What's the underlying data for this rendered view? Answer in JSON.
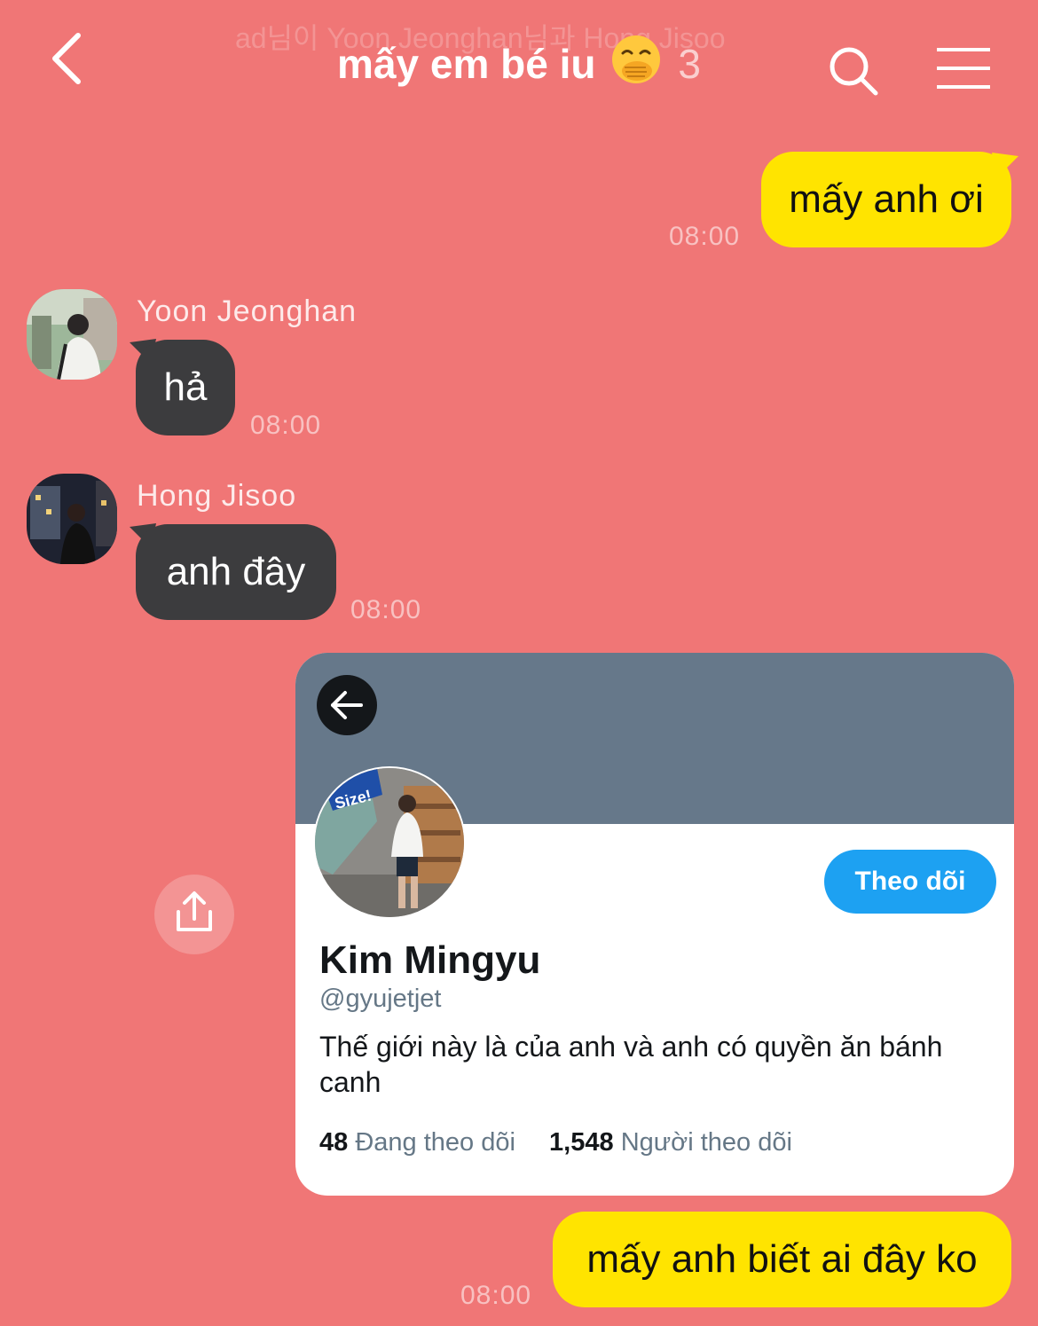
{
  "header": {
    "ghost_text": "ad님이 Yoon Jeonghan님과 Hong Jisoo",
    "title": "mấy em bé iu",
    "member_count": "3"
  },
  "messages": [
    {
      "sender": "me",
      "text": "mấy anh ơi",
      "time": "08:00"
    },
    {
      "sender": "Yoon Jeonghan",
      "text": "hả",
      "time": "08:00"
    },
    {
      "sender": "Hong Jisoo",
      "text": "anh đây",
      "time": "08:00"
    },
    {
      "sender": "me",
      "text": "mấy anh biết ai đây ko",
      "time": "08:00"
    }
  ],
  "profile_card": {
    "follow_label": "Theo dõi",
    "name": "Kim Mingyu",
    "handle": "@gyujetjet",
    "bio": "Thế giới này là của anh và anh có quyền ăn bánh canh",
    "following_count": "48",
    "following_label": "Đang theo dõi",
    "followers_count": "1,548",
    "followers_label": "Người theo dõi",
    "avatar_label": "Size!"
  },
  "colors": {
    "background": "#F07676",
    "my_bubble": "#FFE400",
    "their_bubble": "#3C3C3E",
    "follow_button": "#1DA1F2",
    "banner": "#66788A"
  },
  "icons": [
    "back-chevron-icon",
    "smiling-face-with-hand-over-mouth-emoji",
    "search-icon",
    "menu-icon",
    "arrow-left-icon",
    "share-icon"
  ]
}
